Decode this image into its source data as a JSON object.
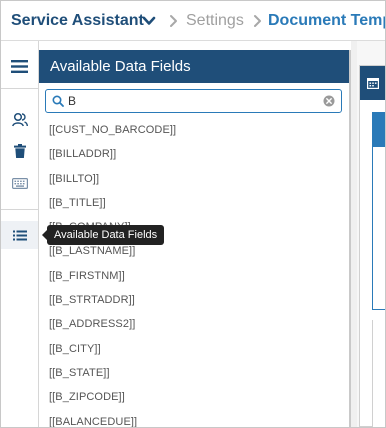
{
  "breadcrumb": {
    "app": "Service Assistant",
    "settings": "Settings",
    "current": "Document Temp"
  },
  "rail": {
    "icons": [
      "menu-icon",
      "users-icon",
      "trash-icon",
      "keyboard-icon",
      "list-icon"
    ]
  },
  "panel": {
    "title": "Available Data Fields",
    "search_value": "B",
    "fields": [
      "[[CUST_NO_BARCODE]]",
      "[[BILLADDR]]",
      "[[BILLTO]]",
      "[[B_TITLE]]",
      "[[B_COMPANY]]",
      "[[B_LASTNAME]]",
      "[[B_FIRSTNM]]",
      "[[B_STRTADDR]]",
      "[[B_ADDRESS2]]",
      "[[B_CITY]]",
      "[[B_STATE]]",
      "[[B_ZIPCODE]]",
      "[[BALANCEDUE]]"
    ]
  },
  "tooltip": {
    "text": "Available Data Fields"
  },
  "colors": {
    "primary": "#1f4e79",
    "accent": "#2a7ab8",
    "muted": "#a0a0a0"
  }
}
